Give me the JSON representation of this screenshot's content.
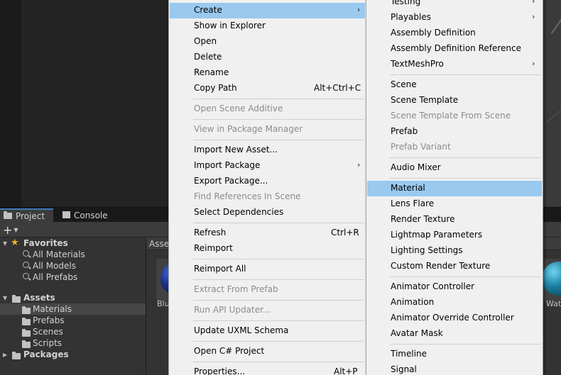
{
  "bottom_panel": {
    "tabs": [
      {
        "label": "Project",
        "icon": "folder-icon"
      },
      {
        "label": "Console",
        "icon": "console-icon"
      }
    ],
    "add_button": "+",
    "tree": {
      "favorites": {
        "label": "Favorites",
        "items": [
          "All Materials",
          "All Models",
          "All Prefabs"
        ]
      },
      "assets": {
        "label": "Assets",
        "items": [
          "Materials",
          "Prefabs",
          "Scenes",
          "Scripts"
        ],
        "selected": "Materials"
      },
      "packages": {
        "label": "Packages"
      }
    },
    "breadcrumb": "Asse",
    "asset_tiles": [
      {
        "label": "Blu",
        "color": "#1b2f8a"
      },
      {
        "label": "Wate",
        "color": "#1b7fa0"
      }
    ]
  },
  "context_menu": {
    "items": [
      {
        "label": "Create",
        "submenu": true,
        "highlighted": true
      },
      {
        "label": "Show in Explorer"
      },
      {
        "label": "Open"
      },
      {
        "label": "Delete"
      },
      {
        "label": "Rename"
      },
      {
        "label": "Copy Path",
        "shortcut": "Alt+Ctrl+C"
      },
      {
        "label": "Open Scene Additive",
        "disabled": true
      },
      {
        "label": "View in Package Manager",
        "disabled": true
      },
      {
        "label": "Import New Asset..."
      },
      {
        "label": "Import Package",
        "submenu": true
      },
      {
        "label": "Export Package..."
      },
      {
        "label": "Find References In Scene",
        "disabled": true
      },
      {
        "label": "Select Dependencies"
      },
      {
        "label": "Refresh",
        "shortcut": "Ctrl+R"
      },
      {
        "label": "Reimport"
      },
      {
        "label": "Reimport All"
      },
      {
        "label": "Extract From Prefab",
        "disabled": true
      },
      {
        "label": "Run API Updater...",
        "disabled": true
      },
      {
        "label": "Update UXML Schema"
      },
      {
        "label": "Open C# Project"
      },
      {
        "label": "Properties...",
        "shortcut": "Alt+P"
      }
    ]
  },
  "create_submenu": {
    "items": [
      {
        "label": "Testing",
        "submenu": true
      },
      {
        "label": "Playables",
        "submenu": true
      },
      {
        "label": "Assembly Definition"
      },
      {
        "label": "Assembly Definition Reference"
      },
      {
        "label": "TextMeshPro",
        "submenu": true
      },
      {
        "label": "Scene"
      },
      {
        "label": "Scene Template"
      },
      {
        "label": "Scene Template From Scene",
        "disabled": true
      },
      {
        "label": "Prefab"
      },
      {
        "label": "Prefab Variant",
        "disabled": true
      },
      {
        "label": "Audio Mixer"
      },
      {
        "label": "Material",
        "highlighted": true
      },
      {
        "label": "Lens Flare"
      },
      {
        "label": "Render Texture"
      },
      {
        "label": "Lightmap Parameters"
      },
      {
        "label": "Lighting Settings"
      },
      {
        "label": "Custom Render Texture"
      },
      {
        "label": "Animator Controller"
      },
      {
        "label": "Animation"
      },
      {
        "label": "Animator Override Controller"
      },
      {
        "label": "Avatar Mask"
      },
      {
        "label": "Timeline"
      },
      {
        "label": "Signal"
      }
    ]
  },
  "colors": {
    "menu_bg": "#f0f0f0",
    "menu_highlight": "#99c9ef",
    "menu_disabled_text": "#8c8c8c",
    "editor_dark": "#282828",
    "selection": "#464646",
    "favorites_star": "#f0b428"
  }
}
